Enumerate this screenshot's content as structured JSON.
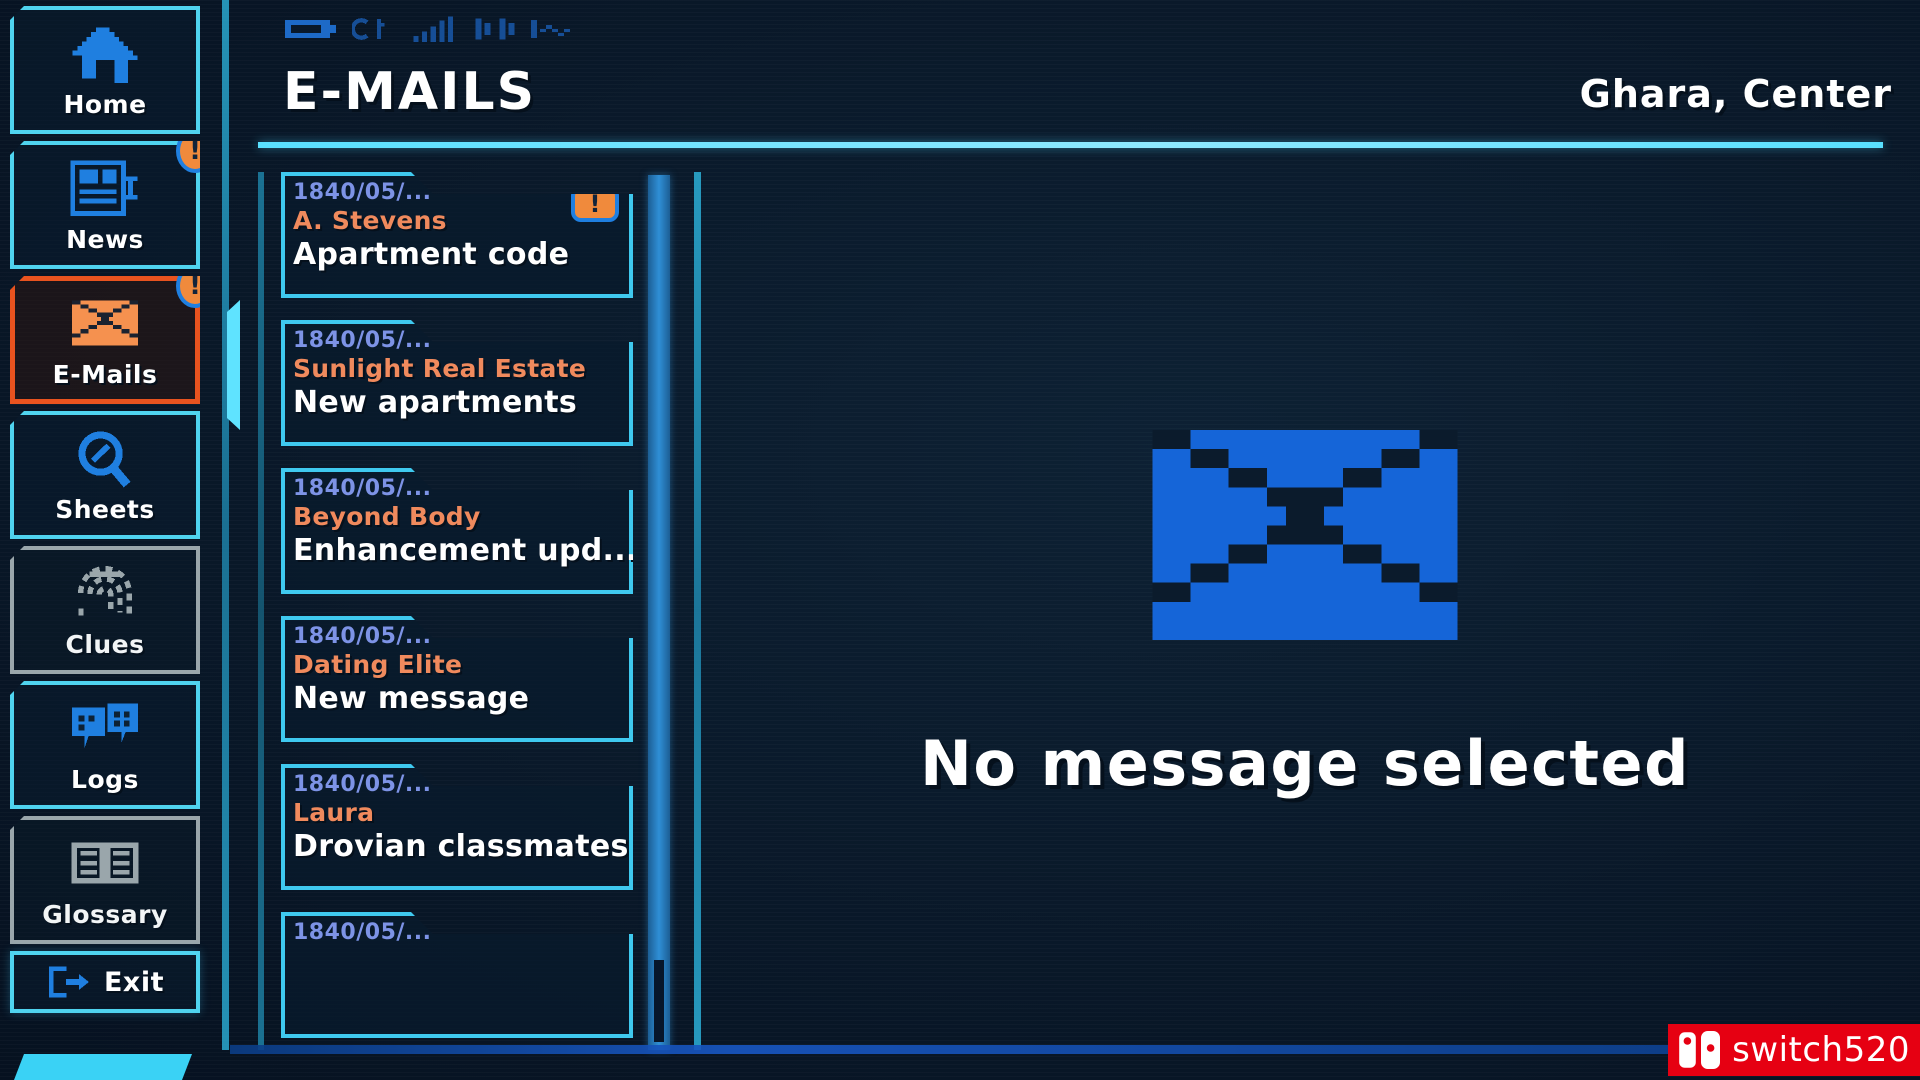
{
  "window": {
    "title": "E-MAILS",
    "location": "Ghara, Center"
  },
  "statusbar": {
    "icons": [
      "battery-icon",
      "signal-bars-icon",
      "network-icon",
      "wave-icon"
    ],
    "battery_label": "",
    "signal_label": ""
  },
  "sidebar": {
    "items": [
      {
        "label": "Home",
        "icon": "house-icon",
        "state": "enabled",
        "badge": null
      },
      {
        "label": "News",
        "icon": "newspaper-icon",
        "state": "enabled",
        "badge": "!"
      },
      {
        "label": "E-Mails",
        "icon": "envelope-icon",
        "state": "active",
        "badge": "!"
      },
      {
        "label": "Sheets",
        "icon": "magnifier-icon",
        "state": "enabled",
        "badge": null
      },
      {
        "label": "Clues",
        "icon": "fingerprint-icon",
        "state": "disabled",
        "badge": null
      },
      {
        "label": "Logs",
        "icon": "chat-bubbles-icon",
        "state": "enabled",
        "badge": null
      },
      {
        "label": "Glossary",
        "icon": "book-icon",
        "state": "disabled",
        "badge": null
      }
    ],
    "exit": {
      "label": "Exit",
      "icon": "exit-door-icon"
    }
  },
  "mail_list": [
    {
      "date": "1840/05/...",
      "sender": "A. Stevens",
      "subject": "Apartment code",
      "badge": "!"
    },
    {
      "date": "1840/05/...",
      "sender": "Sunlight Real Estate",
      "subject": "New apartments",
      "badge": null
    },
    {
      "date": "1840/05/...",
      "sender": "Beyond Body",
      "subject": "Enhancement upd...",
      "badge": null
    },
    {
      "date": "1840/05/...",
      "sender": "Dating Elite",
      "subject": "New message",
      "badge": null
    },
    {
      "date": "1840/05/...",
      "sender": "Laura",
      "subject": "Drovian classmates",
      "badge": null
    },
    {
      "date": "1840/05/...",
      "sender": "",
      "subject": "",
      "badge": null
    }
  ],
  "detail": {
    "icon": "large-envelope-icon",
    "empty_message": "No message selected"
  },
  "watermark": {
    "text": "switch520",
    "icon": "nintendo-switch-icon"
  },
  "colors": {
    "accent_cyan": "#4fd3ef",
    "accent_blue": "#1f7fe0",
    "accent_orange": "#e8531f",
    "badge_orange": "#f08a3c",
    "sender_orange": "#f08a5d",
    "date_violet": "#7d93e6",
    "disabled_grey": "#9aa6ab",
    "background": "#0a1a2b",
    "text_white": "#ffffff",
    "watermark_red": "#e60012"
  }
}
